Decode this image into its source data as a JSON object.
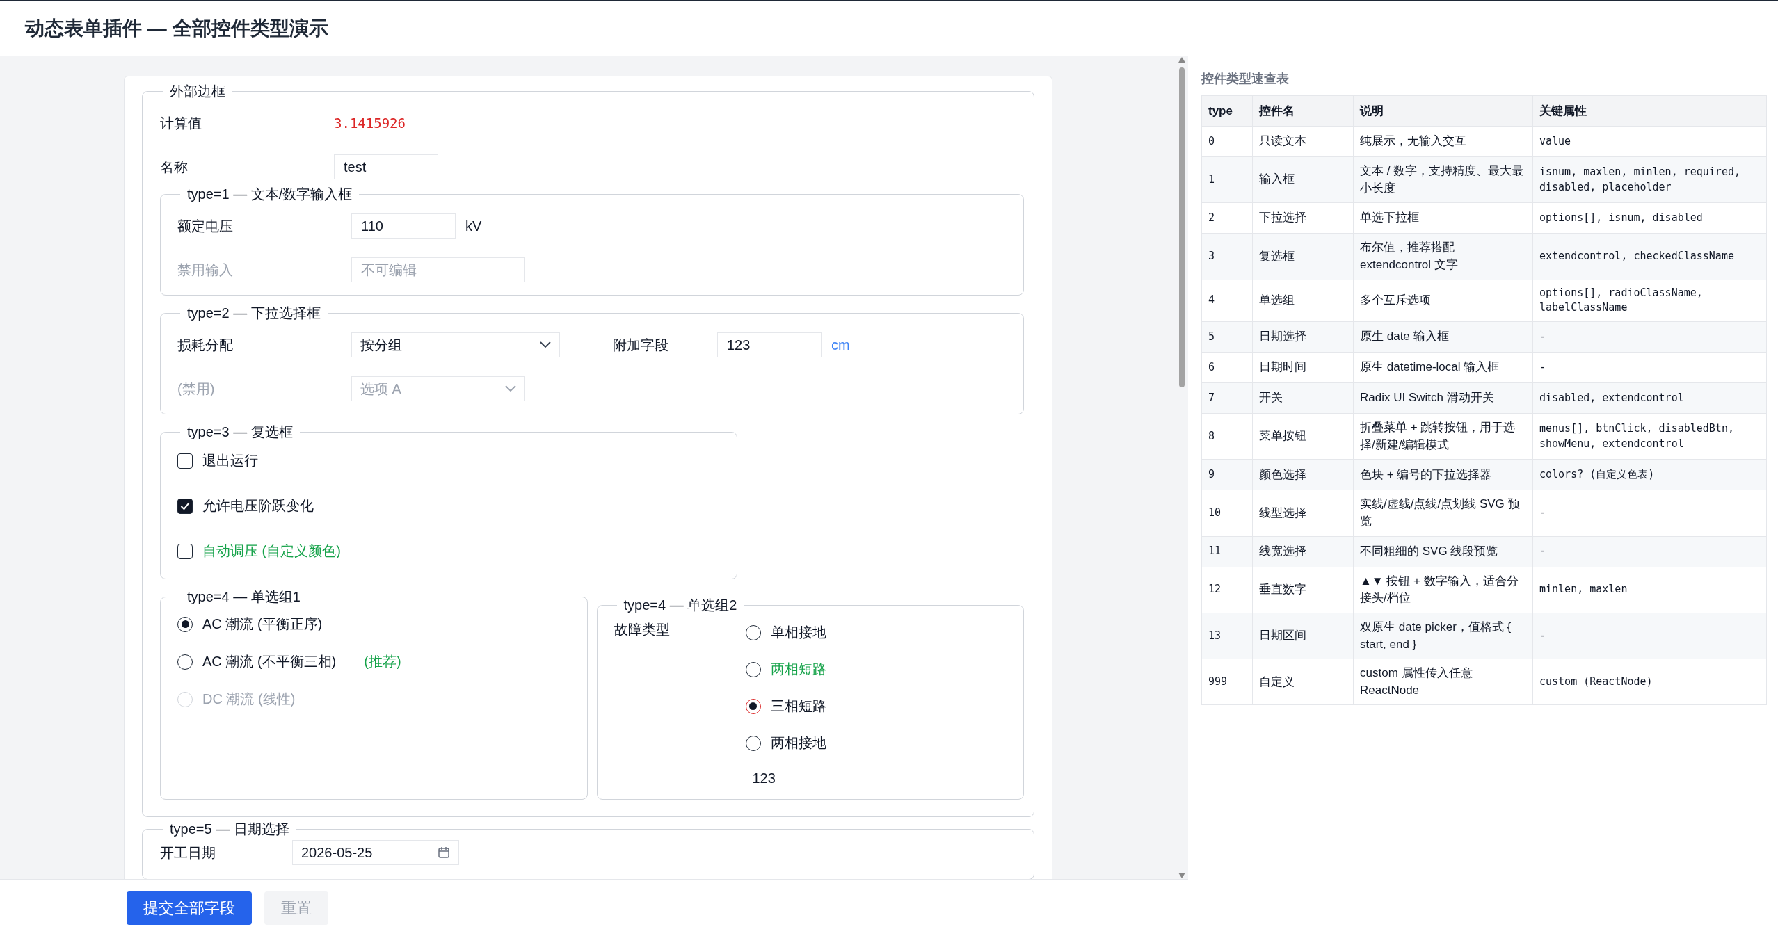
{
  "header": {
    "title": "动态表单插件 — 全部控件类型演示"
  },
  "form": {
    "legend": "外部边框",
    "computed": {
      "label": "计算值",
      "value": "3.1415926"
    },
    "name": {
      "label": "名称",
      "value": "test"
    },
    "inputs": {
      "legend": "type=1 — 文本/数字输入框",
      "rows": [
        {
          "label": "额定电压",
          "value": "110",
          "unit": "kV",
          "disabled": false
        },
        {
          "label": "禁用输入",
          "placeholder": "不可编辑",
          "disabled": true
        }
      ]
    },
    "selects": {
      "legend": "type=2 — 下拉选择框",
      "rows": [
        {
          "label": "损耗分配",
          "value": "按分组",
          "disabled": false,
          "extra": {
            "label": "附加字段",
            "value": "123",
            "unit": "cm"
          }
        },
        {
          "label": "(禁用)",
          "value": "选项 A",
          "disabled": true
        }
      ]
    },
    "checkboxes": {
      "legend": "type=3 — 复选框",
      "items": [
        {
          "label": "退出运行",
          "checked": false
        },
        {
          "label": "允许电压阶跃变化",
          "checked": true
        },
        {
          "label": "自动调压 (自定义颜色)",
          "checked": false,
          "color": "#16a34a"
        }
      ]
    },
    "radio_groups": [
      {
        "legend": "type=4 — 单选组1",
        "kind": "plain",
        "options": [
          {
            "label": "AC 潮流 (平衡正序)",
            "selected": true,
            "disabled": false
          },
          {
            "label": "AC 潮流 (不平衡三相)",
            "selected": false,
            "disabled": false,
            "note": "(推荐)"
          },
          {
            "label": "DC 潮流 (线性)",
            "selected": false,
            "disabled": true
          }
        ]
      },
      {
        "legend": "type=4 — 单选组2",
        "kind": "labeled",
        "label": "故障类型",
        "footer": "123",
        "options": [
          {
            "label": "单相接地",
            "selected": false,
            "disabled": false
          },
          {
            "label": "两相短路",
            "selected": false,
            "disabled": false,
            "color": "#16a34a"
          },
          {
            "label": "三相短路",
            "selected": true,
            "disabled": false
          },
          {
            "label": "两相接地",
            "selected": false,
            "disabled": false
          }
        ]
      }
    ],
    "date": {
      "legend": "type=5 — 日期选择",
      "label": "开工日期",
      "value": "2026-05-25"
    }
  },
  "actions": [
    {
      "label": "提交全部字段",
      "kind": "primary"
    },
    {
      "label": "重置",
      "kind": "secondary"
    }
  ],
  "reference": {
    "title": "控件类型速查表",
    "columns": [
      "type",
      "控件名",
      "说明",
      "关键属性"
    ],
    "rows": [
      [
        "0",
        "只读文本",
        "纯展示，无输入交互",
        "value"
      ],
      [
        "1",
        "输入框",
        "文本 / 数字，支持精度、最大最小长度",
        "isnum, maxlen, minlen, required, disabled, placeholder"
      ],
      [
        "2",
        "下拉选择",
        "单选下拉框",
        "options[], isnum, disabled"
      ],
      [
        "3",
        "复选框",
        "布尔值，推荐搭配 extendcontrol 文字",
        "extendcontrol, checkedClassName"
      ],
      [
        "4",
        "单选组",
        "多个互斥选项",
        "options[], radioClassName, labelClassName"
      ],
      [
        "5",
        "日期选择",
        "原生 date 输入框",
        "-"
      ],
      [
        "6",
        "日期时间",
        "原生 datetime-local 输入框",
        "-"
      ],
      [
        "7",
        "开关",
        "Radix UI Switch 滑动开关",
        "disabled, extendcontrol"
      ],
      [
        "8",
        "菜单按钮",
        "折叠菜单 + 跳转按钮，用于选择/新建/编辑模式",
        "menus[], btnClick, disabledBtn, showMenu, extendcontrol"
      ],
      [
        "9",
        "颜色选择",
        "色块 + 编号的下拉选择器",
        "colors? (自定义色表)"
      ],
      [
        "10",
        "线型选择",
        "实线/虚线/点线/点划线 SVG 预览",
        "-"
      ],
      [
        "11",
        "线宽选择",
        "不同粗细的 SVG 线段预览",
        "-"
      ],
      [
        "12",
        "垂直数字",
        "▲▼ 按钮 + 数字输入，适合分接头/档位",
        "minlen, maxlen"
      ],
      [
        "13",
        "日期区间",
        "双原生 date picker，值格式 { start, end }",
        "-"
      ],
      [
        "999",
        "自定义",
        "custom 属性传入任意 ReactNode",
        "custom (ReactNode)"
      ]
    ]
  }
}
